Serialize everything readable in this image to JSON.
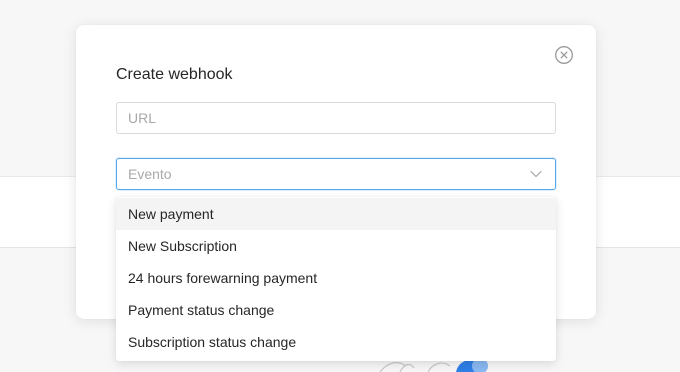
{
  "modal": {
    "title": "Create webhook",
    "close_icon": "close-circle-icon",
    "url_field": {
      "placeholder": "URL",
      "value": ""
    },
    "event_select": {
      "placeholder": "Evento",
      "selected": "",
      "icon": "chevron-down-icon",
      "focus_color": "#56a8ee"
    }
  },
  "dropdown": {
    "options": [
      "New payment",
      "New Subscription",
      "24 hours forewarning payment",
      "Payment status change",
      "Subscription status change"
    ],
    "highlighted_index": 0
  },
  "background": {
    "accent_color": "#2f7fe8"
  }
}
